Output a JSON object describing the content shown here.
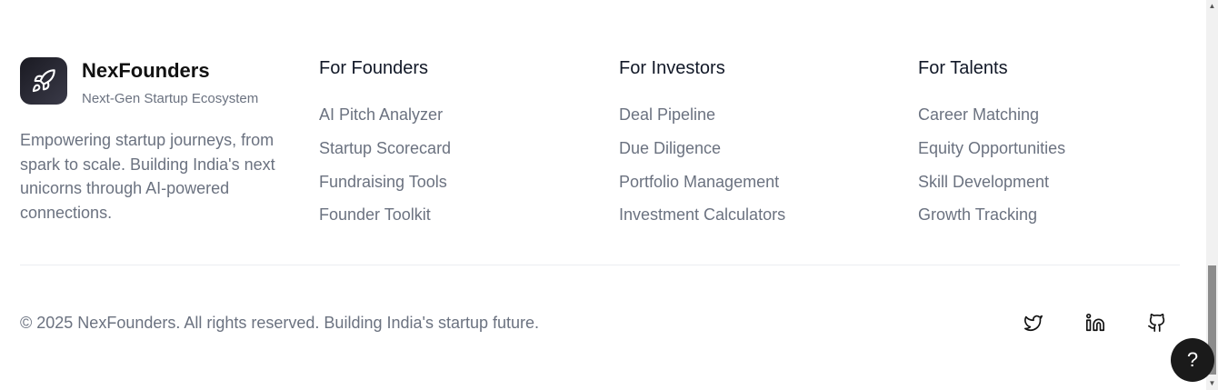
{
  "brand": {
    "name": "NexFounders",
    "tagline": "Next-Gen Startup Ecosystem",
    "description": "Empowering startup journeys, from spark to scale. Building India's next unicorns through AI-powered connections.",
    "logo_icon": "rocket-icon"
  },
  "columns": [
    {
      "title": "For Founders",
      "links": [
        "AI Pitch Analyzer",
        "Startup Scorecard",
        "Fundraising Tools",
        "Founder Toolkit"
      ]
    },
    {
      "title": "For Investors",
      "links": [
        "Deal Pipeline",
        "Due Diligence",
        "Portfolio Management",
        "Investment Calculators"
      ]
    },
    {
      "title": "For Talents",
      "links": [
        "Career Matching",
        "Equity Opportunities",
        "Skill Development",
        "Growth Tracking"
      ]
    }
  ],
  "footer": {
    "copyright": "© 2025 NexFounders. All rights reserved. Building India's startup future.",
    "social_icons": [
      "twitter-icon",
      "linkedin-icon",
      "github-icon"
    ]
  },
  "help": {
    "label": "?"
  },
  "colors": {
    "text_primary": "#111827",
    "text_muted": "#6b7280",
    "logo_bg": "#1a1a22",
    "divider": "#eceef1"
  }
}
